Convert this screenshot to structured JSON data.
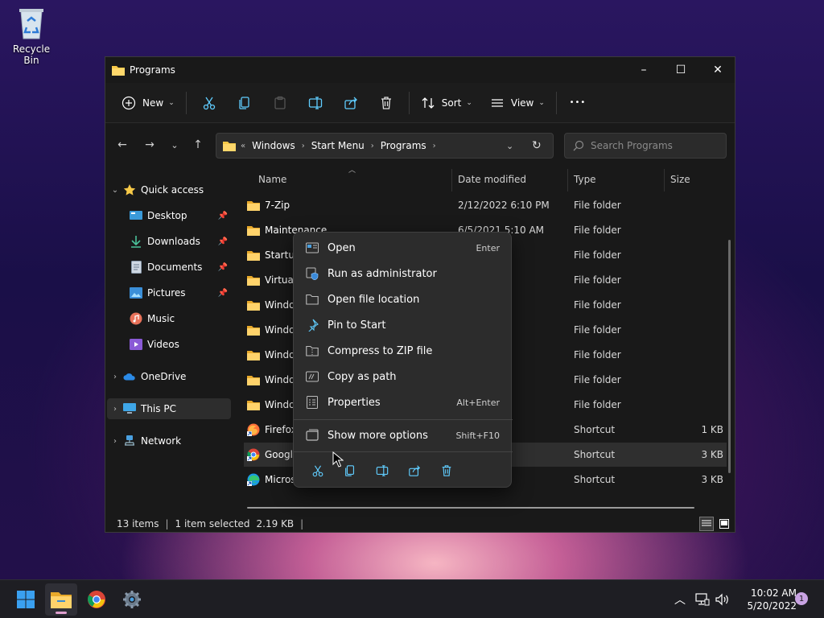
{
  "desktop": {
    "recycle_bin_label": "Recycle Bin"
  },
  "window": {
    "title": "Programs",
    "controls": {
      "minimize": "–",
      "maximize": "☐",
      "close": "✕"
    }
  },
  "toolbar": {
    "new_label": "New",
    "sort_label": "Sort",
    "view_label": "View",
    "more_label": "•••"
  },
  "address": {
    "overflow": "«",
    "crumbs": [
      "Windows",
      "Start Menu",
      "Programs"
    ]
  },
  "search": {
    "placeholder": "Search Programs"
  },
  "sidebar": {
    "quick_access": "Quick access",
    "items": [
      {
        "label": "Desktop",
        "icon": "desktop-icon",
        "pinned": true
      },
      {
        "label": "Downloads",
        "icon": "download-icon",
        "pinned": true
      },
      {
        "label": "Documents",
        "icon": "document-icon",
        "pinned": true
      },
      {
        "label": "Pictures",
        "icon": "picture-icon",
        "pinned": true
      },
      {
        "label": "Music",
        "icon": "music-icon",
        "pinned": false
      },
      {
        "label": "Videos",
        "icon": "video-icon",
        "pinned": false
      }
    ],
    "onedrive": "OneDrive",
    "this_pc": "This PC",
    "network": "Network"
  },
  "columns": {
    "name": "Name",
    "date": "Date modified",
    "type": "Type",
    "size": "Size"
  },
  "rows": [
    {
      "name": "7-Zip",
      "date": "2/12/2022 6:10 PM",
      "type": "File folder",
      "size": "",
      "icon": "folder"
    },
    {
      "name": "Maintenance",
      "date": "6/5/2021 5:10 AM",
      "type": "File folder",
      "size": "",
      "icon": "folder"
    },
    {
      "name": "Startup",
      "date": "AM",
      "type": "File folder",
      "size": "",
      "icon": "folder"
    },
    {
      "name": "Virtual",
      "date": "9 PM",
      "type": "File folder",
      "size": "",
      "icon": "folder"
    },
    {
      "name": "Windo",
      "date": "42 PM",
      "type": "File folder",
      "size": "",
      "icon": "folder"
    },
    {
      "name": "Windo",
      "date": "AM",
      "type": "File folder",
      "size": "",
      "icon": "folder"
    },
    {
      "name": "Windo",
      "date": "AM",
      "type": "File folder",
      "size": "",
      "icon": "folder"
    },
    {
      "name": "Windo",
      "date": "0 PM",
      "type": "File folder",
      "size": "",
      "icon": "folder"
    },
    {
      "name": "Windo",
      "date": "0 PM",
      "type": "File folder",
      "size": "",
      "icon": "folder"
    },
    {
      "name": "Firefox",
      "date": "0 PM",
      "type": "Shortcut",
      "size": "1 KB",
      "icon": "firefox"
    },
    {
      "name": "Google",
      "date": "17 PM",
      "type": "Shortcut",
      "size": "3 KB",
      "icon": "chrome"
    },
    {
      "name": "Micros",
      "date": "35 PM",
      "type": "Shortcut",
      "size": "3 KB",
      "icon": "edge"
    }
  ],
  "selected_row": 10,
  "status": {
    "count": "13 items",
    "selection": "1 item selected",
    "size": "2.19 KB"
  },
  "context_menu": {
    "items": [
      {
        "label": "Open",
        "shortcut": "Enter",
        "icon": "open-icon"
      },
      {
        "label": "Run as administrator",
        "shortcut": "",
        "icon": "shield-icon"
      },
      {
        "label": "Open file location",
        "shortcut": "",
        "icon": "folder-outline-icon"
      },
      {
        "label": "Pin to Start",
        "shortcut": "",
        "icon": "pin-icon"
      },
      {
        "label": "Compress to ZIP file",
        "shortcut": "",
        "icon": "zip-icon"
      },
      {
        "label": "Copy as path",
        "shortcut": "",
        "icon": "copy-path-icon"
      },
      {
        "label": "Properties",
        "shortcut": "Alt+Enter",
        "icon": "properties-icon"
      }
    ],
    "more": {
      "label": "Show more options",
      "shortcut": "Shift+F10"
    }
  },
  "taskbar": {
    "time": "10:02 AM",
    "date": "5/20/2022",
    "notification_count": "1"
  },
  "colors": {
    "accent": "#60cdff",
    "folder": "#f7c948",
    "window_bg": "#191919",
    "menu_bg": "#2c2c2c"
  }
}
